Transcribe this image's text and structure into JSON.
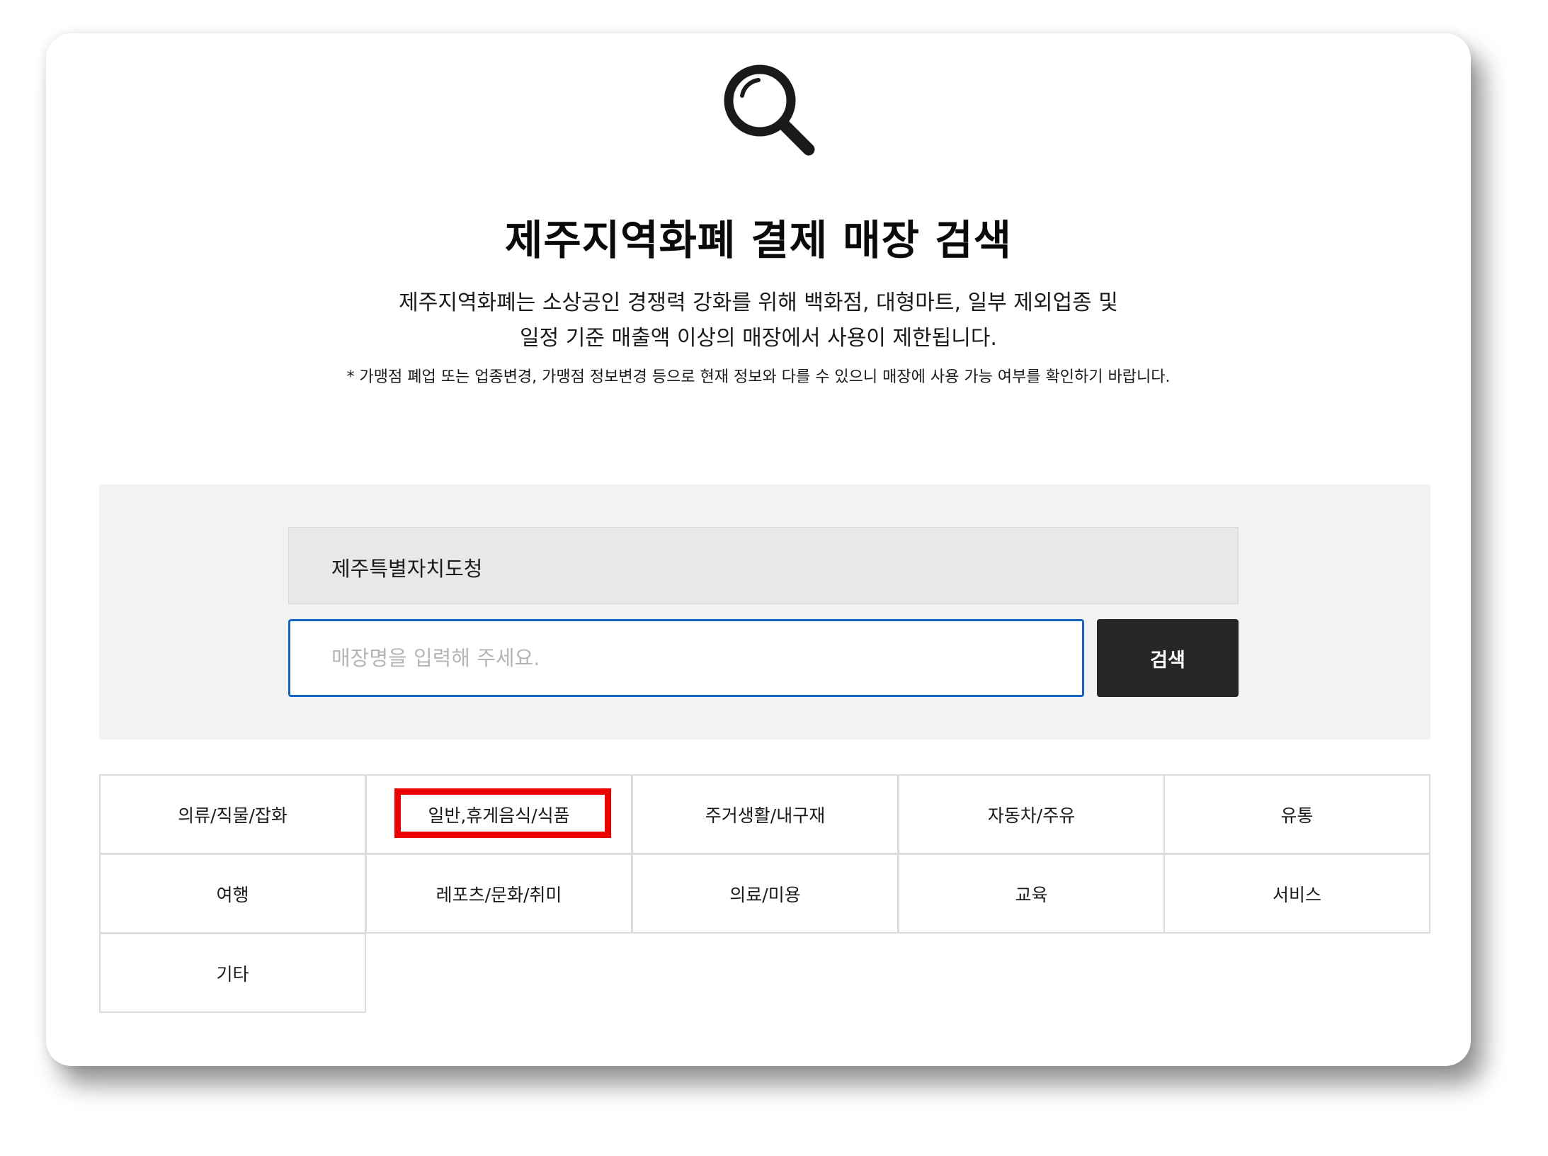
{
  "header": {
    "icon": "magnifier-icon",
    "title": "제주지역화폐 결제 매장 검색",
    "description_line1": "제주지역화폐는 소상공인 경쟁력 강화를 위해 백화점, 대형마트, 일부 제외업종 및",
    "description_line2": "일정 기준 매출액 이상의 매장에서 사용이 제한됩니다.",
    "note": "* 가맹점 폐업 또는 업종변경, 가맹점 정보변경 등으로 현재 정보와 다를 수 있으니 매장에 사용 가능 여부를 확인하기 바랍니다."
  },
  "search": {
    "region_value": "제주특별자치도청",
    "input_value": "",
    "input_placeholder": "매장명을 입력해 주세요.",
    "button_label": "검색",
    "input_border_color": "#1565c0",
    "button_color": "#272727"
  },
  "categories": [
    {
      "label": "의류/직물/잡화"
    },
    {
      "label": "일반,휴게음식/식품",
      "highlighted": true
    },
    {
      "label": "주거생활/내구재"
    },
    {
      "label": "자동차/주유"
    },
    {
      "label": "유통"
    },
    {
      "label": "여행"
    },
    {
      "label": "레포츠/문화/취미"
    },
    {
      "label": "의료/미용"
    },
    {
      "label": "교육"
    },
    {
      "label": "서비스"
    },
    {
      "label": "기타"
    }
  ],
  "highlight_color": "#ee0000"
}
